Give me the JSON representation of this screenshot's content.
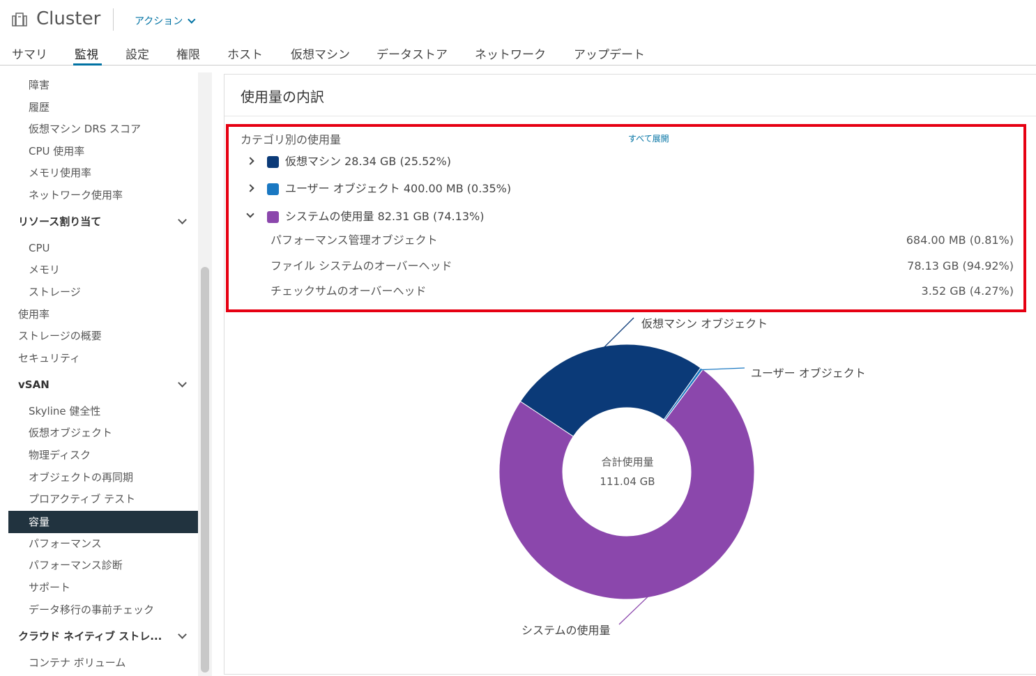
{
  "header": {
    "title": "Cluster",
    "actions_label": "アクション",
    "icon": "cluster-icon"
  },
  "tabs": [
    {
      "label": "サマリ"
    },
    {
      "label": "監視"
    },
    {
      "label": "設定"
    },
    {
      "label": "権限"
    },
    {
      "label": "ホスト"
    },
    {
      "label": "仮想マシン"
    },
    {
      "label": "データストア"
    },
    {
      "label": "ネットワーク"
    },
    {
      "label": "アップデート"
    }
  ],
  "active_tab": "監視",
  "sidebar": {
    "items": [
      {
        "label": "障害"
      },
      {
        "label": "履歴"
      },
      {
        "label": "仮想マシン DRS スコア"
      },
      {
        "label": "CPU 使用率"
      },
      {
        "label": "メモリ使用率"
      },
      {
        "label": "ネットワーク使用率"
      },
      {
        "label": "リソース割り当て"
      },
      {
        "label": "CPU"
      },
      {
        "label": "メモリ"
      },
      {
        "label": "ストレージ"
      },
      {
        "label": "使用率"
      },
      {
        "label": "ストレージの概要"
      },
      {
        "label": "セキュリティ"
      },
      {
        "label": "vSAN"
      },
      {
        "label": "Skyline 健全性"
      },
      {
        "label": "仮想オブジェクト"
      },
      {
        "label": "物理ディスク"
      },
      {
        "label": "オブジェクトの再同期"
      },
      {
        "label": "プロアクティブ テスト"
      },
      {
        "label": "容量"
      },
      {
        "label": "パフォーマンス"
      },
      {
        "label": "パフォーマンス診断"
      },
      {
        "label": "サポート"
      },
      {
        "label": "データ移行の事前チェック"
      },
      {
        "label": "クラウド ネイティブ ストレ..."
      },
      {
        "label": "コンテナ ボリューム"
      }
    ]
  },
  "panel": {
    "title": "使用量の内訳",
    "category_label": "カテゴリ別の使用量",
    "expand_all": "すべて展開",
    "categories": [
      {
        "label": "仮想マシン 28.34 GB (25.52%)",
        "color": "#0b3a78"
      },
      {
        "label": "ユーザー オブジェクト 400.00 MB (0.35%)",
        "color": "#1a78c2"
      },
      {
        "label": "システムの使用量 82.31 GB (74.13%)",
        "color": "#8b47ac"
      }
    ],
    "system_details": [
      {
        "name": "パフォーマンス管理オブジェクト",
        "value": "684.00 MB (0.81%)"
      },
      {
        "name": "ファイル システムのオーバーヘッド",
        "value": "78.13 GB (94.92%)"
      },
      {
        "name": "チェックサムのオーバーヘッド",
        "value": "3.52 GB (4.27%)"
      }
    ]
  },
  "chart_data": {
    "type": "pie",
    "title": "",
    "center_label": "合計使用量",
    "center_value": "111.04 GB",
    "slices": [
      {
        "label": "仮想マシン オブジェクト",
        "percent": 25.52,
        "color": "#0b3a78"
      },
      {
        "label": "ユーザー オブジェクト",
        "percent": 0.35,
        "color": "#1a78c2"
      },
      {
        "label": "システムの使用量",
        "percent": 74.13,
        "color": "#8b47ac"
      }
    ]
  }
}
